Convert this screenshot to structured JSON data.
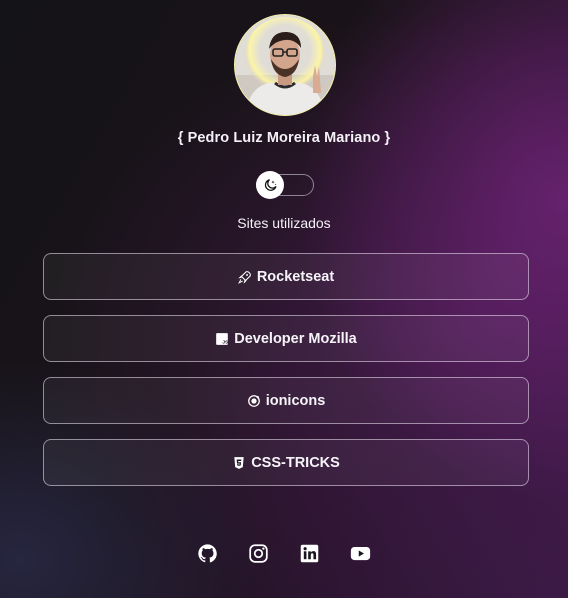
{
  "profile": {
    "name": "{ Pedro Luiz Moreira Mariano }",
    "avatar_icon": "profile-photo"
  },
  "theme_toggle": {
    "icon": "moon-icon",
    "state": "off"
  },
  "section": {
    "title": "Sites utilizados"
  },
  "links": [
    {
      "label": "Rocketseat",
      "icon": "rocket-icon"
    },
    {
      "label": "Developer Mozilla",
      "icon": "javascript-icon"
    },
    {
      "label": "ionicons",
      "icon": "ionic-icon"
    },
    {
      "label": "CSS-TRICKS",
      "icon": "css3-icon"
    }
  ],
  "social": [
    {
      "icon": "github-icon"
    },
    {
      "icon": "instagram-icon"
    },
    {
      "icon": "linkedin-icon"
    },
    {
      "icon": "youtube-icon"
    }
  ],
  "colors": {
    "avatar_ring": "#f7f3a8",
    "button_border": "#e6dcec",
    "accent_purple": "#5a1e62",
    "text": "#f4f1f7"
  }
}
